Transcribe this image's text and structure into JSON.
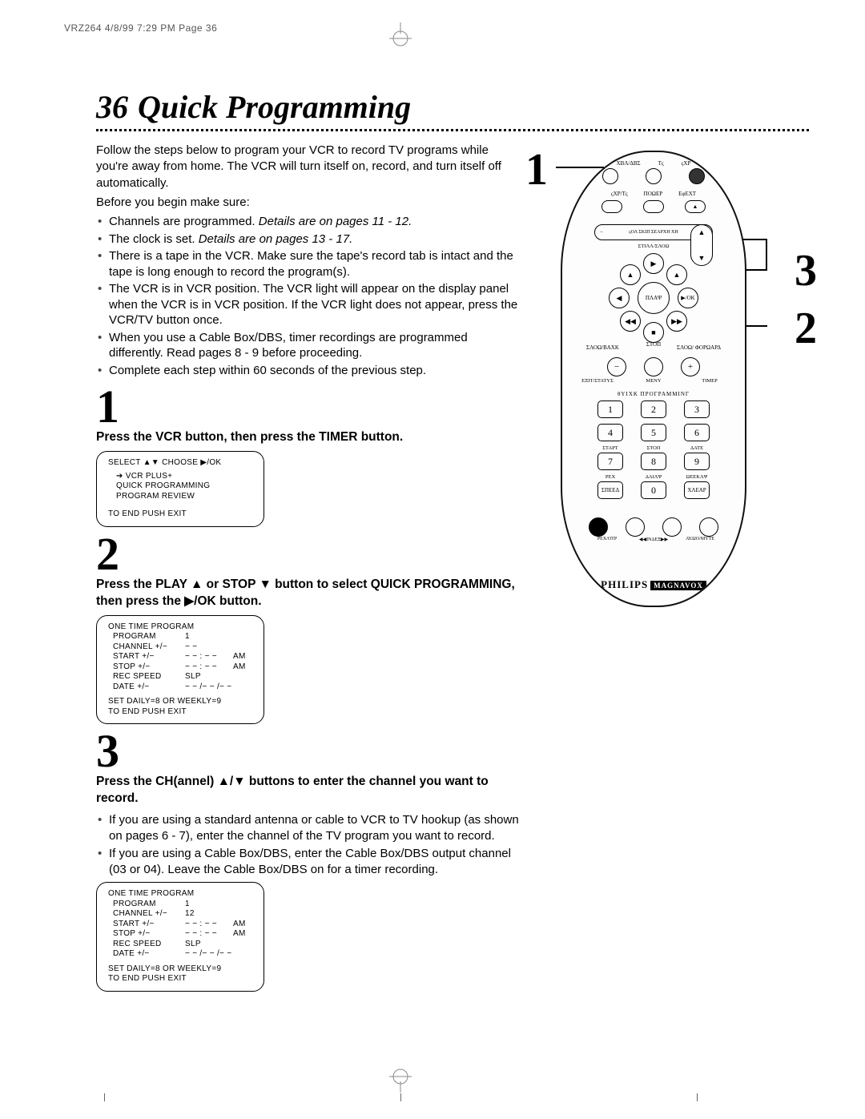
{
  "header": "VRZ264  4/8/99 7:29 PM  Page 36",
  "page_number": "36",
  "title": "Quick Programming",
  "intro": {
    "p1": "Follow the steps below to program your VCR to record TV programs while you're away from home. The VCR will turn itself on, record, and turn itself off automatically.",
    "p2": "Before you begin make sure:"
  },
  "prep_items": [
    {
      "text": "Channels are programmed. ",
      "italic": "Details are on pages 11 - 12."
    },
    {
      "text": "The clock is set. ",
      "italic": "Details are on pages 13 - 17."
    },
    {
      "text": "There is a tape in the VCR. Make sure the tape's record tab is intact and the tape is long enough to record the program(s)."
    },
    {
      "text": "The VCR is in VCR position. The VCR light will appear on the display panel when the VCR is in VCR position. If the VCR light does not appear, press the VCR/TV button once."
    },
    {
      "text": "When you use a Cable Box/DBS, timer recordings are programmed differently. Read pages 8 - 9 before proceeding."
    },
    {
      "text": "Complete each step within 60 seconds of the previous step."
    }
  ],
  "steps": {
    "s1": {
      "num": "1",
      "head": "Press the VCR button, then press the TIMER button.",
      "screen": {
        "line1": "SELECT  ▲▼       CHOOSE ▶/OK",
        "items": [
          "➔ VCR PLUS+",
          "QUICK PROGRAMMING",
          "PROGRAM REVIEW"
        ],
        "footer": "TO END PUSH EXIT"
      }
    },
    "s2": {
      "num": "2",
      "head": "Press the PLAY ▲ or STOP ▼ button to select QUICK PROGRAMMING, then press the ▶/OK button.",
      "screen": {
        "title": "ONE TIME PROGRAM",
        "rows": [
          [
            "PROGRAM",
            "1",
            ""
          ],
          [
            "CHANNEL +/−",
            "− −",
            ""
          ],
          [
            "START +/−",
            "− − : − −",
            "AM"
          ],
          [
            "STOP +/−",
            "− − : − −",
            "AM"
          ],
          [
            "REC SPEED",
            "SLP",
            ""
          ],
          [
            "DATE +/−",
            "− − /− − /− −",
            ""
          ]
        ],
        "foot1": "SET DAILY=8 OR WEEKLY=9",
        "foot2": "TO END PUSH EXIT"
      }
    },
    "s3": {
      "num": "3",
      "head": "Press the CH(annel) ▲/▼ buttons to enter the channel you want to record.",
      "bullets": [
        "If you are using a standard antenna or cable to VCR to TV hookup (as shown on pages 6 - 7), enter the channel of the TV program you want to record.",
        "If you are using a Cable Box/DBS, enter the Cable Box/DBS output channel (03 or 04). Leave the Cable Box/DBS on for a timer recording."
      ],
      "screen": {
        "title": "ONE TIME PROGRAM",
        "rows": [
          [
            "PROGRAM",
            "1",
            ""
          ],
          [
            "CHANNEL +/−",
            "12",
            ""
          ],
          [
            "START +/−",
            "− − : − −",
            "AM"
          ],
          [
            "STOP +/−",
            "− − : − −",
            "AM"
          ],
          [
            "REC SPEED",
            "SLP",
            ""
          ],
          [
            "DATE +/−",
            "− − /− − /− −",
            ""
          ]
        ],
        "foot1": "SET DAILY=8 OR WEEKLY=9",
        "foot2": "TO END PUSH EXIT"
      }
    }
  },
  "remote": {
    "callouts": {
      "c1": "1",
      "c2": "2",
      "c3": "3"
    },
    "top_labels": [
      "ΧΒΛ/ΔΒΣ",
      "Τς",
      "ςΧΡ"
    ],
    "row2_labels": [
      "ςΧΡ/Τς",
      "ΠΟΩΕΡ",
      "ΕφΕΧΤ"
    ],
    "skip_search": "ςΟΛ   ΣΚΙΠ ΣΕΑΡΧΗ   ΧΗ",
    "still": "ΣΤΙΛΛ/ΣΛΟΩ",
    "play": "ΠΛΑΨ",
    "ok": "▶/ΟΚ",
    "stop": "ΣΤΟΠ",
    "slow_back": "ΣΛΟΩ/ΒΑΧΚ",
    "slow_fwd": "ΣΛΟΩ/ ΦΟΡΩΑΡΔ",
    "bot3_labels": [
      "ΕΞΙΤ/ΣΤΑΤΥΣ",
      "ΜΕΝΥ",
      "ΤΙΜΕΡ"
    ],
    "keypad_title": "θΥΙΧΚ ΠΡΟΓΡΑΜΜΙΝΓ",
    "keypad_row_labels": [
      [
        "",
        "",
        ""
      ],
      [
        "ΣΤΑΡΤ",
        "ΣΤΟΠ",
        "ΔΑΤΕ"
      ],
      [
        "ΡΕΧ",
        "ΔΑΙΛΨ",
        "ΩΕΕΚΛΨ"
      ]
    ],
    "keypad": [
      [
        "1",
        "2",
        "3"
      ],
      [
        "4",
        "5",
        "6"
      ],
      [
        "7",
        "8",
        "9"
      ],
      [
        "ΣΠΕΕΔ",
        "0",
        "ΧΛΕΑΡ"
      ]
    ],
    "bot_icons_labels": [
      "ΡΕΧ/ΟΤΡ",
      "◀◀ΙΝΔΕΞ▶▶",
      "ΑΥΔΙΟ/ΜΥΤΕ"
    ],
    "brand": "PHILIPS",
    "brand2": "MAGNAVOX"
  }
}
